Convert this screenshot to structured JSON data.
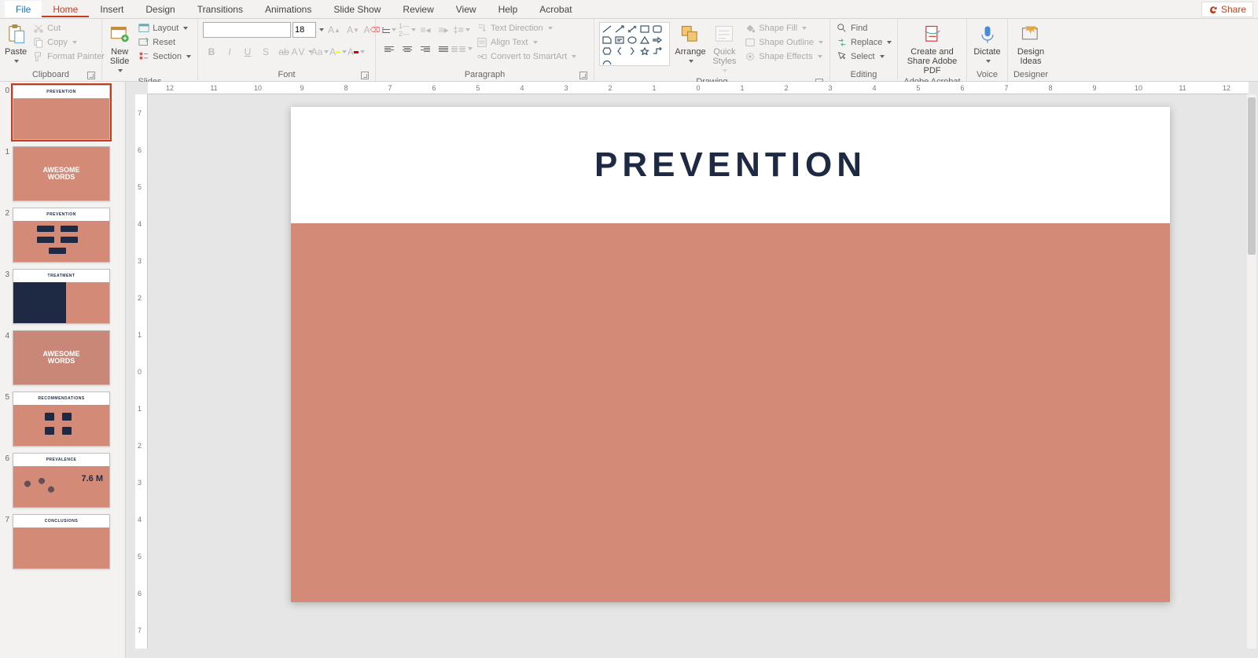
{
  "tabs": {
    "file": "File",
    "home": "Home",
    "insert": "Insert",
    "design": "Design",
    "transitions": "Transitions",
    "animations": "Animations",
    "slideshow": "Slide Show",
    "review": "Review",
    "view": "View",
    "help": "Help",
    "acrobat": "Acrobat",
    "share": "Share"
  },
  "ribbon": {
    "clipboard": {
      "label": "Clipboard",
      "paste": "Paste",
      "cut": "Cut",
      "copy": "Copy",
      "painter": "Format Painter"
    },
    "slides": {
      "label": "Slides",
      "new": "New Slide",
      "layout": "Layout",
      "reset": "Reset",
      "section": "Section"
    },
    "font": {
      "label": "Font",
      "name": "",
      "size": "18"
    },
    "paragraph": {
      "label": "Paragraph",
      "textdir": "Text Direction",
      "align": "Align Text",
      "smartart": "Convert to SmartArt"
    },
    "drawing": {
      "label": "Drawing",
      "arrange": "Arrange",
      "quick": "Quick Styles",
      "fill": "Shape Fill",
      "outline": "Shape Outline",
      "effects": "Shape Effects"
    },
    "editing": {
      "label": "Editing",
      "find": "Find",
      "replace": "Replace",
      "select": "Select"
    },
    "acrobat": {
      "label": "Adobe Acrobat",
      "create": "Create and Share Adobe PDF"
    },
    "voice": {
      "label": "Voice",
      "dictate": "Dictate"
    },
    "designer": {
      "label": "Designer",
      "ideas": "Design Ideas"
    }
  },
  "ruler": {
    "h": [
      "12",
      "11",
      "10",
      "9",
      "8",
      "7",
      "6",
      "5",
      "4",
      "3",
      "2",
      "1",
      "0",
      "1",
      "2",
      "3",
      "4",
      "5",
      "6",
      "7",
      "8",
      "9",
      "10",
      "11",
      "12"
    ],
    "v": [
      "7",
      "6",
      "5",
      "4",
      "3",
      "2",
      "1",
      "0",
      "1",
      "2",
      "3",
      "4",
      "5",
      "6",
      "7"
    ]
  },
  "slide": {
    "title": "PREVENTION"
  },
  "thumbs": {
    "t0": "PREVENTION",
    "t1a": "AWESOME",
    "t1b": "WORDS",
    "t2": "PREVENTION",
    "t3": "TREATMENT",
    "t4a": "AWESOME",
    "t4b": "WORDS",
    "t5": "RECOMMENDATIONS",
    "t6": "PREVALENCE",
    "t6v": "7.6 M",
    "t7": "CONCLUSIONS"
  }
}
